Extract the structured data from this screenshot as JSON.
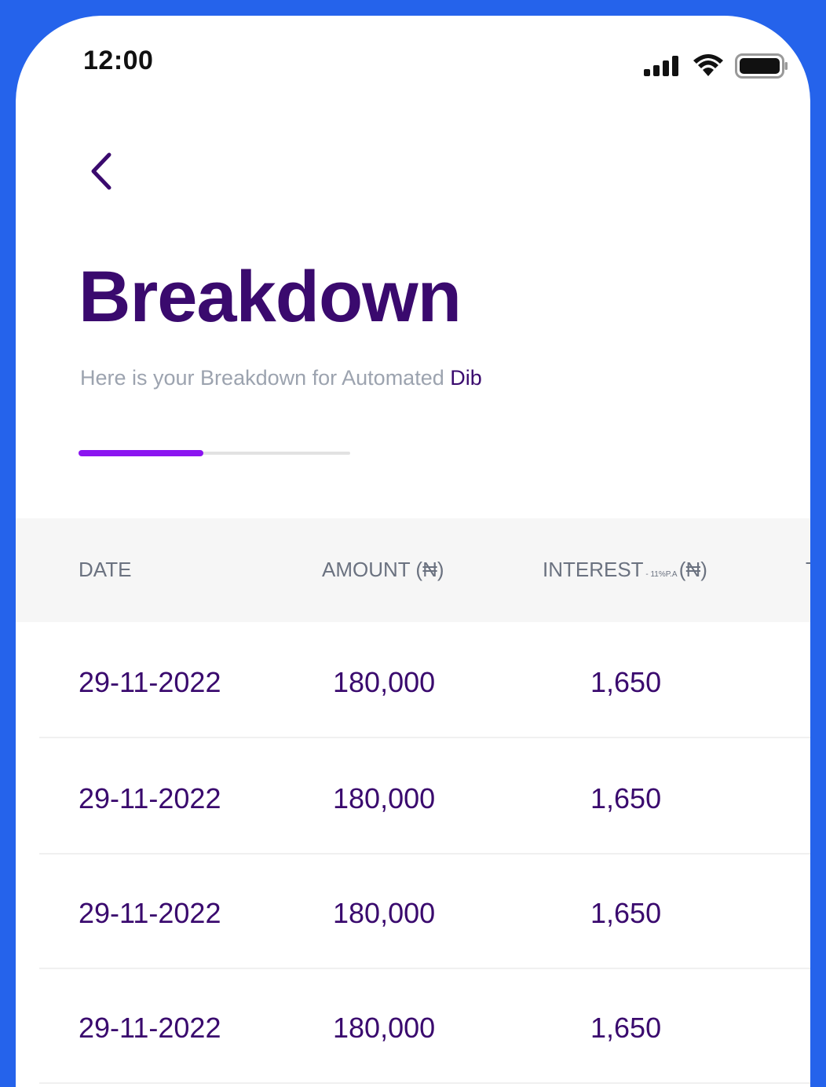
{
  "status_bar": {
    "time": "12:00"
  },
  "header": {
    "title": "Breakdown",
    "subtitle_prefix": "Here is your Breakdown for Automated ",
    "subtitle_accent": "Dib"
  },
  "progress": {
    "fraction": 0.46
  },
  "table": {
    "columns": {
      "date": "DATE",
      "amount": "AMOUNT (₦)",
      "interest_label": "INTEREST",
      "interest_rate": " - 11%P.A ",
      "interest_unit": "(₦)",
      "fourth_partial": "T"
    },
    "rows": [
      {
        "date": "29-11-2022",
        "amount": "180,000",
        "interest": "1,650"
      },
      {
        "date": "29-11-2022",
        "amount": "180,000",
        "interest": "1,650"
      },
      {
        "date": "29-11-2022",
        "amount": "180,000",
        "interest": "1,650"
      },
      {
        "date": "29-11-2022",
        "amount": "180,000",
        "interest": "1,650"
      }
    ]
  },
  "colors": {
    "frame": "#2563EB",
    "primary": "#3A0A6E",
    "progress": "#8B14F0",
    "muted": "#9CA3AF"
  }
}
